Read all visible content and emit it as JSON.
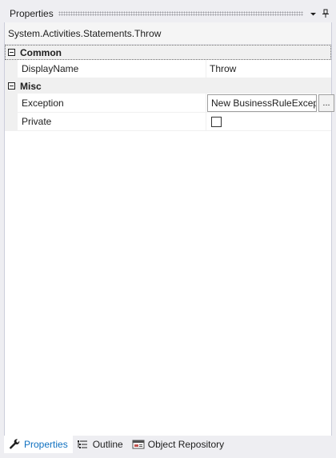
{
  "panel": {
    "title": "Properties",
    "object_type": "System.Activities.Statements.Throw"
  },
  "titlebar_buttons": {
    "menu_icon": "dropdown-arrow-icon",
    "pin_icon": "pin-icon"
  },
  "categories": [
    {
      "name": "Common",
      "expanded": true,
      "properties": [
        {
          "name": "DisplayName",
          "value": "Throw"
        }
      ]
    },
    {
      "name": "Misc",
      "expanded": true,
      "properties": [
        {
          "name": "Exception",
          "value": "New BusinessRuleExcep",
          "button_label": "..."
        },
        {
          "name": "Private",
          "checked": false
        }
      ]
    }
  ],
  "tabs": [
    {
      "label": "Properties",
      "icon": "wrench-icon",
      "active": true
    },
    {
      "label": "Outline",
      "icon": "outline-icon",
      "active": false
    },
    {
      "label": "Object Repository",
      "icon": "object-repository-icon",
      "active": false
    }
  ],
  "colors": {
    "accent": "#0e70c0",
    "background": "#eeeef2",
    "category_background": "#f0f0f0"
  }
}
